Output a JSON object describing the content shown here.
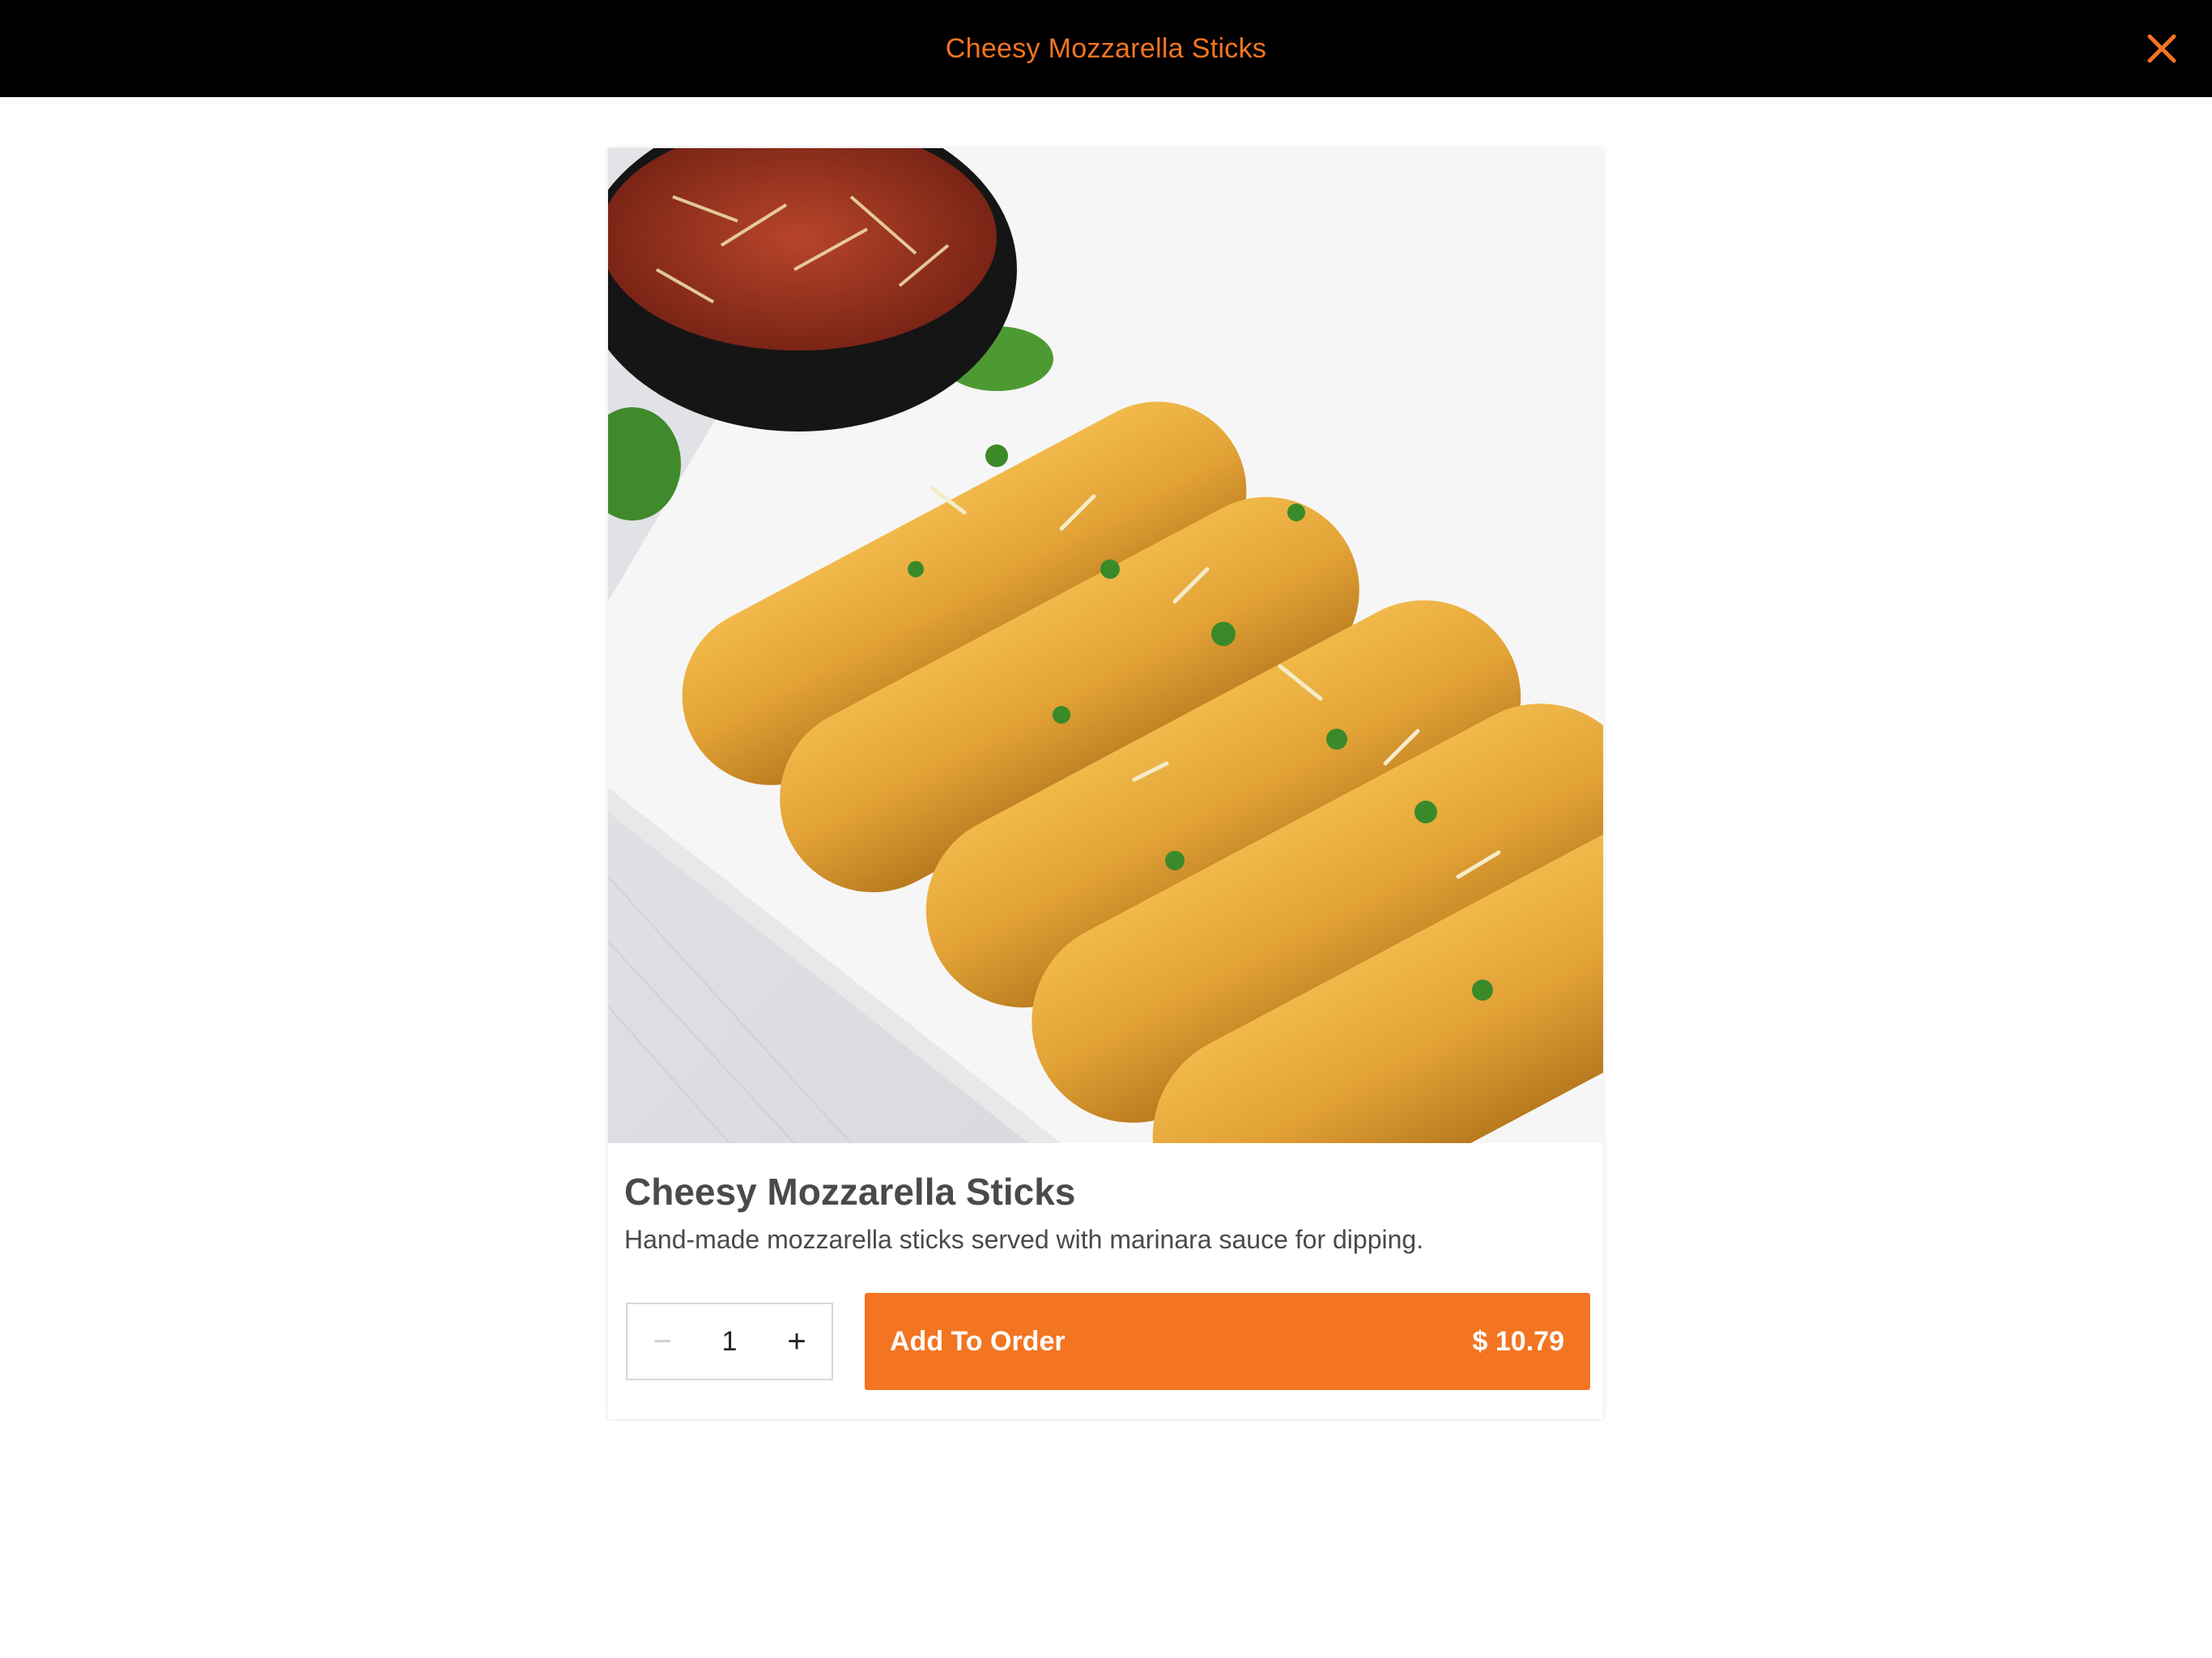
{
  "modal": {
    "title": "Cheesy Mozzarella Sticks",
    "close_icon": "close-icon",
    "accent_color": "#f37521"
  },
  "item": {
    "name": "Cheesy Mozzarella Sticks",
    "description": "Hand-made mozzarella sticks served with marinara sauce for dipping.",
    "quantity": "1",
    "minus_symbol": "−",
    "plus_symbol": "+",
    "add_label": "Add To Order",
    "price": "$ 10.79"
  }
}
